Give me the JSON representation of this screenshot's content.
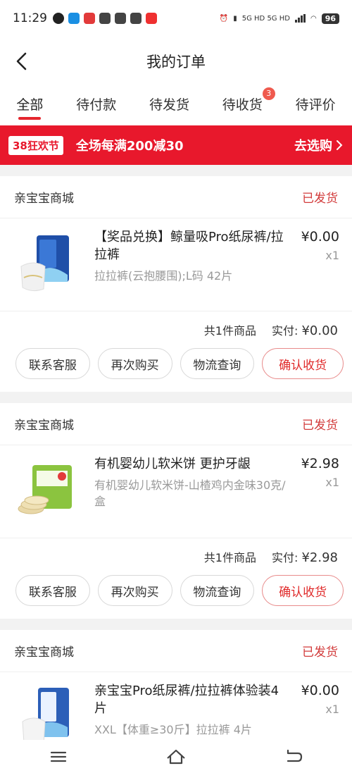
{
  "status_bar": {
    "time": "11:29",
    "network": "5G HD 5G HD",
    "battery": "96"
  },
  "header": {
    "title": "我的订单",
    "back_icon": "chevron-left-icon"
  },
  "tabs": [
    {
      "label": "全部",
      "active": true
    },
    {
      "label": "待付款"
    },
    {
      "label": "待发货"
    },
    {
      "label": "待收货",
      "badge": "3"
    },
    {
      "label": "待评价"
    }
  ],
  "promo": {
    "tag": "38狂欢节",
    "text": "全场每满200减30",
    "cta": "去选购"
  },
  "orders": [
    {
      "shop": "亲宝宝商城",
      "status": "已发货",
      "item": {
        "name": "【奖品兑换】鲸量吸Pro纸尿裤/拉拉裤",
        "spec": "拉拉裤(云抱腰围);L码 42片",
        "price": "¥0.00",
        "qty": "x1"
      },
      "count_text": "共1件商品",
      "paid_label": "实付:",
      "paid_value": "¥0.00",
      "actions": [
        "联系客服",
        "再次购买",
        "物流查询",
        "确认收货"
      ]
    },
    {
      "shop": "亲宝宝商城",
      "status": "已发货",
      "item": {
        "name": "有机婴幼儿软米饼 更护牙龈",
        "spec": "有机婴幼儿软米饼-山楂鸡内金味30克/盒",
        "price": "¥2.98",
        "qty": "x1"
      },
      "count_text": "共1件商品",
      "paid_label": "实付:",
      "paid_value": "¥2.98",
      "actions": [
        "联系客服",
        "再次购买",
        "物流查询",
        "确认收货"
      ]
    },
    {
      "shop": "亲宝宝商城",
      "status": "已发货",
      "item": {
        "name": "亲宝宝Pro纸尿裤/拉拉裤体验装4片",
        "spec": "XXL【体重≥30斤】拉拉裤 4片",
        "price": "¥0.00",
        "qty": "x1"
      }
    }
  ],
  "colors": {
    "accent": "#e8182c",
    "status_red": "#d23a3a"
  }
}
